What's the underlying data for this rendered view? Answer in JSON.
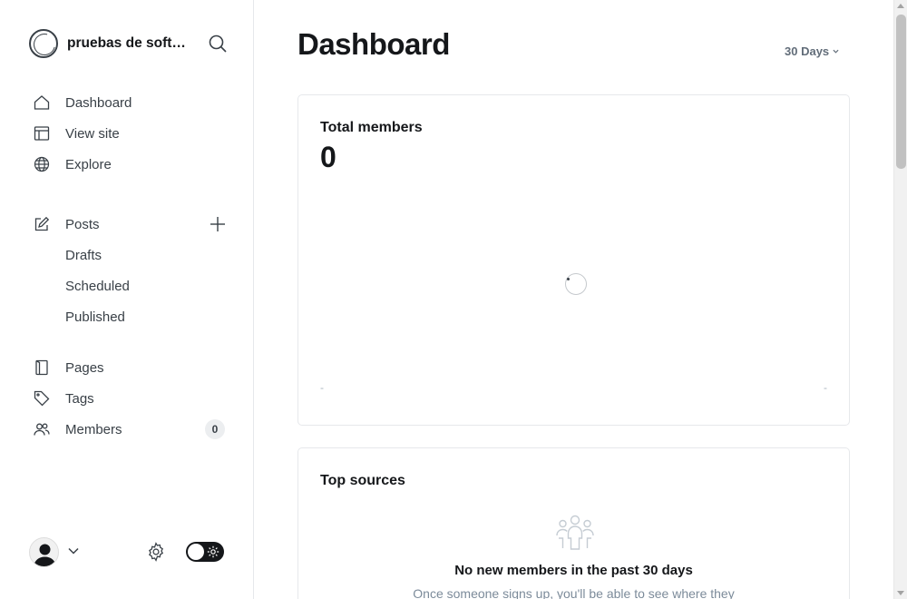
{
  "sidebar": {
    "brand_title": "pruebas de software",
    "nav_primary": [
      {
        "label": "Dashboard",
        "icon": "home-icon"
      },
      {
        "label": "View site",
        "icon": "layout-icon"
      },
      {
        "label": "Explore",
        "icon": "globe-icon"
      }
    ],
    "posts": {
      "label": "Posts",
      "icon": "pencil-icon",
      "sub": [
        "Drafts",
        "Scheduled",
        "Published"
      ]
    },
    "nav_secondary": [
      {
        "label": "Pages",
        "icon": "page-icon"
      },
      {
        "label": "Tags",
        "icon": "tag-icon"
      },
      {
        "label": "Members",
        "icon": "members-icon",
        "count": "0"
      }
    ]
  },
  "header": {
    "title": "Dashboard",
    "range": "30 Days"
  },
  "members_card": {
    "title": "Total members",
    "value": "0",
    "axis_start": "-",
    "axis_end": "-"
  },
  "sources_card": {
    "title": "Top sources",
    "empty_title": "No new members in the past 30 days",
    "empty_desc": "Once someone signs up, you'll be able to see where they"
  },
  "colors": {
    "text_primary": "#15171a",
    "text_secondary": "#394047",
    "muted": "#7c8b9a",
    "border": "#e6e8eb"
  }
}
